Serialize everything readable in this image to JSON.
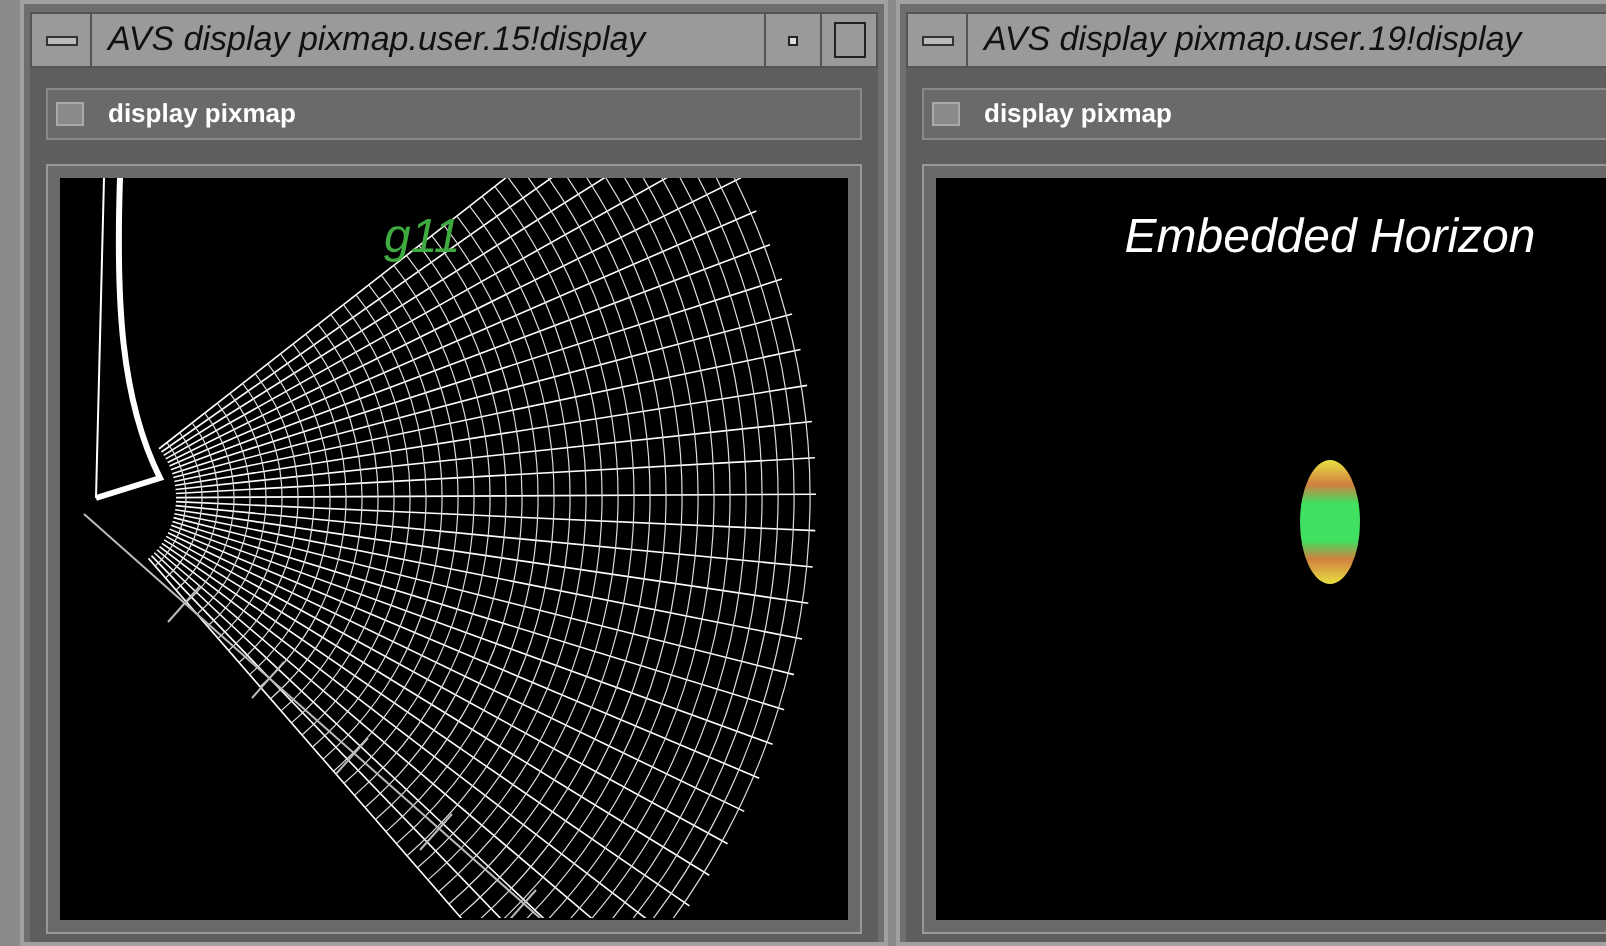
{
  "windows": [
    {
      "title": "AVS display pixmap.user.15!display",
      "toggle": {
        "label": "display pixmap",
        "checked": false
      },
      "canvas": {
        "kind": "mesh",
        "caption": "g11"
      }
    },
    {
      "title": "AVS display pixmap.user.19!display",
      "toggle": {
        "label": "display pixmap",
        "checked": false
      },
      "canvas": {
        "kind": "horizon",
        "caption": "Embedded Horizon"
      }
    }
  ]
}
